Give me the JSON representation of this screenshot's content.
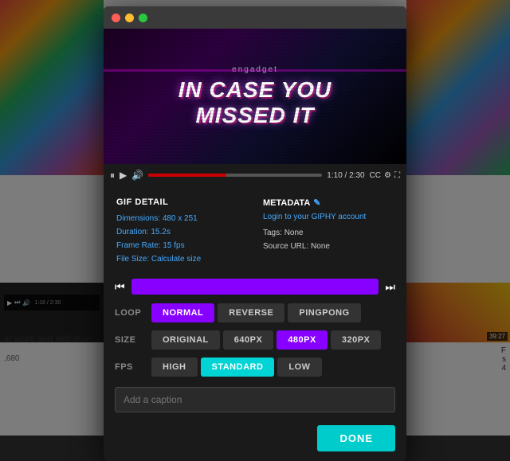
{
  "titlebar": {
    "dots": [
      "#ff5f57",
      "#febc2e",
      "#28c840"
    ]
  },
  "video": {
    "brand": "engadget",
    "title_line1": "IN CASE YOU",
    "title_line2": "MISSED IT"
  },
  "controls": {
    "time_current": "1:10",
    "time_total": "2:30"
  },
  "gif_detail": {
    "heading": "GIF DETAIL",
    "dimensions_label": "Dimensions:",
    "dimensions_value": "480 x 251",
    "duration_label": "Duration:",
    "duration_value": "15.2s",
    "frame_rate_label": "Frame Rate:",
    "frame_rate_value": "15 fps",
    "file_size_label": "File Size:",
    "file_size_link": "Calculate size"
  },
  "metadata": {
    "heading": "METADATA",
    "login_link": "Login to your GIPHY account",
    "tags_label": "Tags:",
    "tags_value": "None",
    "source_label": "Source URL:",
    "source_value": "None"
  },
  "loop": {
    "label": "LOOP",
    "options": [
      "NORMAL",
      "REVERSE",
      "PINGPONG"
    ],
    "active": "NORMAL"
  },
  "size": {
    "label": "SIZE",
    "options": [
      "ORIGINAL",
      "640PX",
      "480PX",
      "320PX"
    ],
    "active": "480PX"
  },
  "fps": {
    "label": "FPS",
    "options": [
      "HIGH",
      "STANDARD",
      "LOW"
    ],
    "active": "STANDARD"
  },
  "caption": {
    "placeholder": "Add a caption"
  },
  "done_button": "DONE",
  "bottom_label": "Cort"
}
